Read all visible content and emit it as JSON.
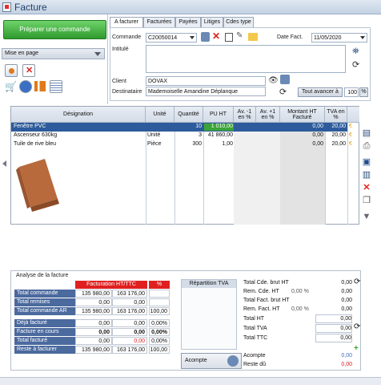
{
  "window": {
    "title": "Facture"
  },
  "left": {
    "main_button": "Préparer une commande",
    "mise_en_page": "Mise en page"
  },
  "tabs": [
    "A facturer",
    "Facturées",
    "Payées",
    "Litiges",
    "Cdes type"
  ],
  "form": {
    "commande_label": "Commande",
    "commande_value": "C20050014",
    "date_label": "Date Fact.",
    "date_value": "11/05/2020",
    "intitule_label": "Intitulé",
    "client_label": "Client",
    "client_value": "DOVAX",
    "dest_label": "Destinataire",
    "dest_value": "Mademoiselle Amandine Déplanque",
    "avancer_label": "Tout avancer à",
    "avancer_value": "100",
    "pct": "%"
  },
  "grid": {
    "headers": [
      "Désignation",
      "Unité",
      "Quantité",
      "PU HT",
      "Av. -1 en %",
      "Av. +1 en %",
      "Montant HT Facturé",
      "TVA en %"
    ],
    "rows": [
      {
        "designation": "Fenêtre PVC",
        "unite": "",
        "quantite": "10",
        "pu": "1 010,00",
        "montant": "0,00",
        "tva": "20,00"
      },
      {
        "designation": "Ascenseur 630kg",
        "unite": "Unité",
        "quantite": "3",
        "pu": "41 860,00",
        "montant": "0,00",
        "tva": "20,00"
      },
      {
        "designation": "Tuile de rive bleu",
        "unite": "Pièce",
        "quantite": "300",
        "pu": "1,00",
        "montant": "0,00",
        "tva": "20,00"
      }
    ]
  },
  "analyse": {
    "title": "Analyse de la facture",
    "col_header": "Facturation HT/TTC",
    "pct_header": "%",
    "rows": [
      {
        "label": "Total commande",
        "ht": "135 980,00",
        "ttc": "163 176,00",
        "pct": ""
      },
      {
        "label": "Total remises",
        "ht": "0,00",
        "ttc": "0,00",
        "pct": ""
      },
      {
        "label": "Total commande AR",
        "ht": "135 980,00",
        "ttc": "163 176,00",
        "pct": "100,00"
      },
      {
        "label": "Déjà facturé",
        "ht": "0,00",
        "ttc": "0,00",
        "pct": "0,00%"
      },
      {
        "label": "Facture en cours",
        "ht": "0,00",
        "ttc": "0,00",
        "pct": "0,00%"
      },
      {
        "label": "Total facturé",
        "ht": "0,00",
        "ttc": "0,00",
        "pct": "0,00%"
      },
      {
        "label": "Reste à facturer",
        "ht": "135 980,00",
        "ttc": "163 176,00",
        "pct": "100,00"
      }
    ]
  },
  "repartition": {
    "title": "Répartition TVA"
  },
  "acompte_btn": "Acompte",
  "totals": {
    "rows": [
      {
        "label": "Total Cde. brut HT",
        "pct": "",
        "value": "0,00"
      },
      {
        "label": "Rem. Cde. HT",
        "pct": "0,00 %",
        "value": "0,00"
      },
      {
        "label": "Total Fact. brut HT",
        "pct": "",
        "value": "0,00"
      },
      {
        "label": "Rem. Fact. HT",
        "pct": "0,00 %",
        "value": "0,00"
      },
      {
        "label": "Total HT",
        "pct": "",
        "value": "0,00"
      },
      {
        "label": "Total TVA",
        "pct": "",
        "value": "0,00"
      },
      {
        "label": "Total TTC",
        "pct": "",
        "value": "0,00"
      }
    ],
    "acompte_label": "Acompte",
    "acompte_value": "0,00",
    "reste_label": "Reste dû",
    "reste_value": "0,00"
  },
  "colors": {
    "accent": "#4b6a9e",
    "green": "#3aa437",
    "red": "#e02020",
    "selected": "#2d5b9b"
  }
}
